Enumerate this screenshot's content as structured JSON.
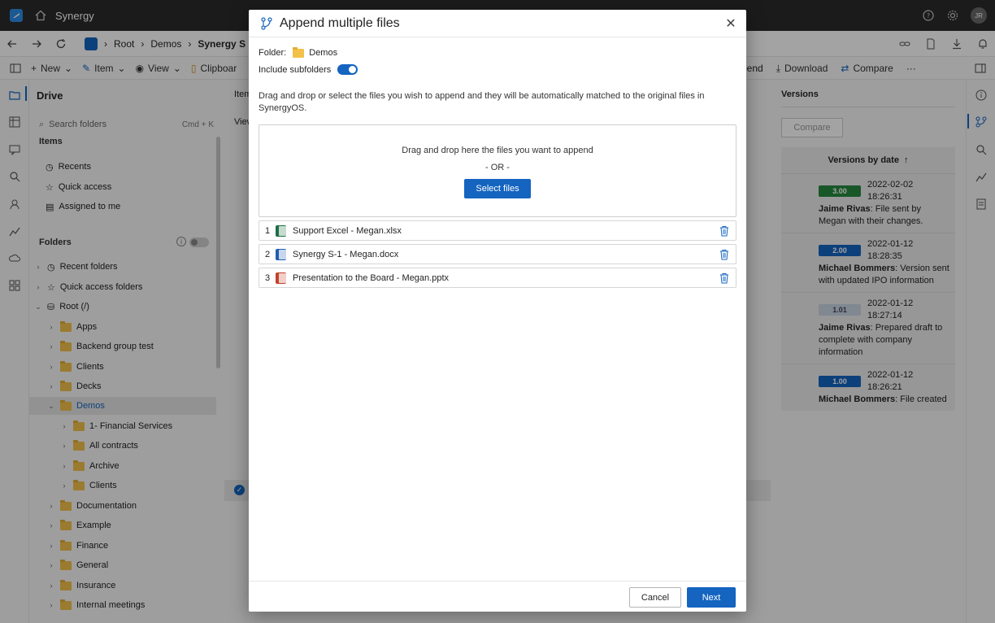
{
  "titlebar": {
    "app_name": "Synergy",
    "avatar_initials": "JR"
  },
  "addressbar": {
    "crumbs": [
      "Root",
      "Demos",
      "Synergy S"
    ]
  },
  "toolbar": {
    "new_label": "New",
    "item_label": "Item",
    "view_label": "View",
    "clipboard_label": "Clipboar",
    "append_label": "pend",
    "download_label": "Download",
    "compare_label": "Compare",
    "more_label": "···"
  },
  "sidebar": {
    "title": "Drive",
    "search_placeholder": "Search folders",
    "search_shortcut": "Cmd + K",
    "items_label": "Items",
    "items": [
      {
        "label": "Recents",
        "icon": "clock-icon"
      },
      {
        "label": "Quick access",
        "icon": "star-icon"
      },
      {
        "label": "Assigned to me",
        "icon": "clipboard-icon"
      }
    ],
    "folders_label": "Folders",
    "tree": [
      {
        "label": "Recent folders"
      },
      {
        "label": "Quick access folders"
      },
      {
        "label": "Root (/)"
      },
      {
        "label": "Apps"
      },
      {
        "label": "Backend group test"
      },
      {
        "label": "Clients"
      },
      {
        "label": "Decks"
      },
      {
        "label": "Demos"
      },
      {
        "label": "1- Financial Services"
      },
      {
        "label": "All contracts"
      },
      {
        "label": "Archive"
      },
      {
        "label": "Clients"
      },
      {
        "label": "Documentation"
      },
      {
        "label": "Example"
      },
      {
        "label": "Finance"
      },
      {
        "label": "General"
      },
      {
        "label": "Insurance"
      },
      {
        "label": "Internal meetings"
      }
    ]
  },
  "center": {
    "items_tab": "Item",
    "view_tab": "View"
  },
  "versions": {
    "title": "Versions",
    "compare_label": "Compare",
    "list_header": "Versions by date",
    "entries": [
      {
        "version": "3.00",
        "date": "2022-02-02 18:26:31",
        "author": "Jaime Rivas",
        "message": ": File sent by Megan with their changes."
      },
      {
        "version": "2.00",
        "date": "2022-01-12 18:28:35",
        "author": "Michael Bommers",
        "message": ": Version sent with updated IPO information"
      },
      {
        "version": "1.01",
        "date": "2022-01-12 18:27:14",
        "author": "Jaime Rivas",
        "message": ": Prepared draft to complete with company information"
      },
      {
        "version": "1.00",
        "date": "2022-01-12 18:26:21",
        "author": "Michael Bommers",
        "message": ": File created"
      }
    ]
  },
  "modal": {
    "title": "Append multiple files",
    "folder_label": "Folder:",
    "folder_name": "Demos",
    "subfolders_label": "Include subfolders",
    "instructions": "Drag and drop or select the files you wish to append and they will be automatically matched to the original files in SynergyOS.",
    "dropzone_text": "Drag and drop here the files you want to append",
    "dropzone_or": "- OR -",
    "select_files_label": "Select files",
    "files": [
      {
        "num": "1",
        "name": "Support Excel - Megan.xlsx",
        "type": "xlsx"
      },
      {
        "num": "2",
        "name": "Synergy S-1 - Megan.docx",
        "type": "docx"
      },
      {
        "num": "3",
        "name": "Presentation to the Board - Megan.pptx",
        "type": "pptx"
      }
    ],
    "cancel_label": "Cancel",
    "next_label": "Next"
  }
}
